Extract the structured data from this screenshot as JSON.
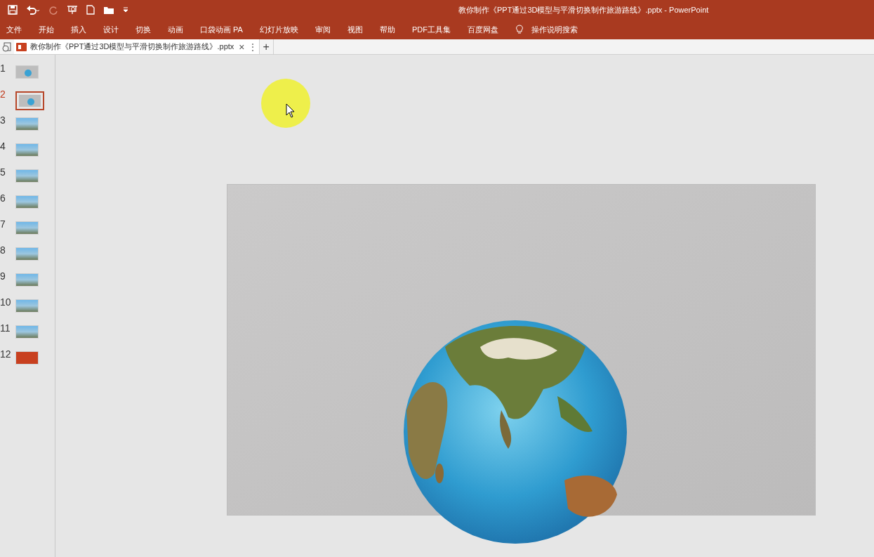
{
  "window": {
    "title": "教你制作《PPT通过3D模型与平滑切换制作旅游路线》.pptx  -  PowerPoint"
  },
  "menu": [
    "文件",
    "开始",
    "插入",
    "设计",
    "切换",
    "动画",
    "口袋动画 PA",
    "幻灯片放映",
    "审阅",
    "视图",
    "帮助",
    "PDF工具集",
    "百度网盘"
  ],
  "search": {
    "placeholder": "操作说明搜索"
  },
  "doc_tab": {
    "label": "教你制作《PPT通过3D模型与平滑切换制作旅游路线》.pptx",
    "selected": true,
    "close": "×",
    "more": "⋮",
    "add": "+"
  },
  "slides": [
    {
      "number": "1",
      "selected": false,
      "kind": "globe"
    },
    {
      "number": "2",
      "selected": true,
      "kind": "globe"
    },
    {
      "number": "3",
      "selected": false,
      "kind": "photo"
    },
    {
      "number": "4",
      "selected": false,
      "kind": "photo"
    },
    {
      "number": "5",
      "selected": false,
      "kind": "photo"
    },
    {
      "number": "6",
      "selected": false,
      "kind": "photo"
    },
    {
      "number": "7",
      "selected": false,
      "kind": "photo"
    },
    {
      "number": "8",
      "selected": false,
      "kind": "photo"
    },
    {
      "number": "9",
      "selected": false,
      "kind": "photo"
    },
    {
      "number": "10",
      "selected": false,
      "kind": "photo"
    },
    {
      "number": "11",
      "selected": false,
      "kind": "photo"
    },
    {
      "number": "12",
      "selected": false,
      "kind": "red"
    }
  ]
}
